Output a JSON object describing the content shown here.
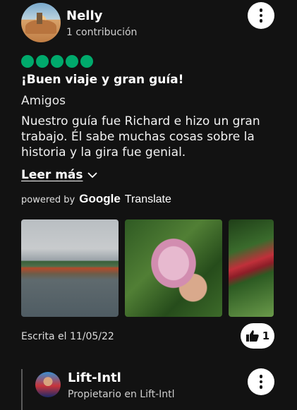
{
  "review": {
    "author": "Nelly",
    "contributions": "1 contribución",
    "rating": 5,
    "title": "¡Buen viaje y gran guía!",
    "trip_type": "Amigos",
    "text": "Nuestro guía fue Richard e hizo un gran trabajo. Él sabe muchas cosas sobre la historia y la gira fue genial.",
    "read_more": "Leer más",
    "powered_by": "powered by",
    "google": "Google",
    "translate": "Translate",
    "written": "Escrita el 11/05/22",
    "helpful_count": "1"
  },
  "photos": [
    {
      "icon": "canal-photo"
    },
    {
      "icon": "flower-photo"
    },
    {
      "icon": "plant-photo"
    }
  ],
  "owner_reply": {
    "name": "Lift-Intl",
    "role": "Propietario en Lift-Intl"
  },
  "colors": {
    "background": "#121212",
    "rating": "#00aa6c"
  }
}
